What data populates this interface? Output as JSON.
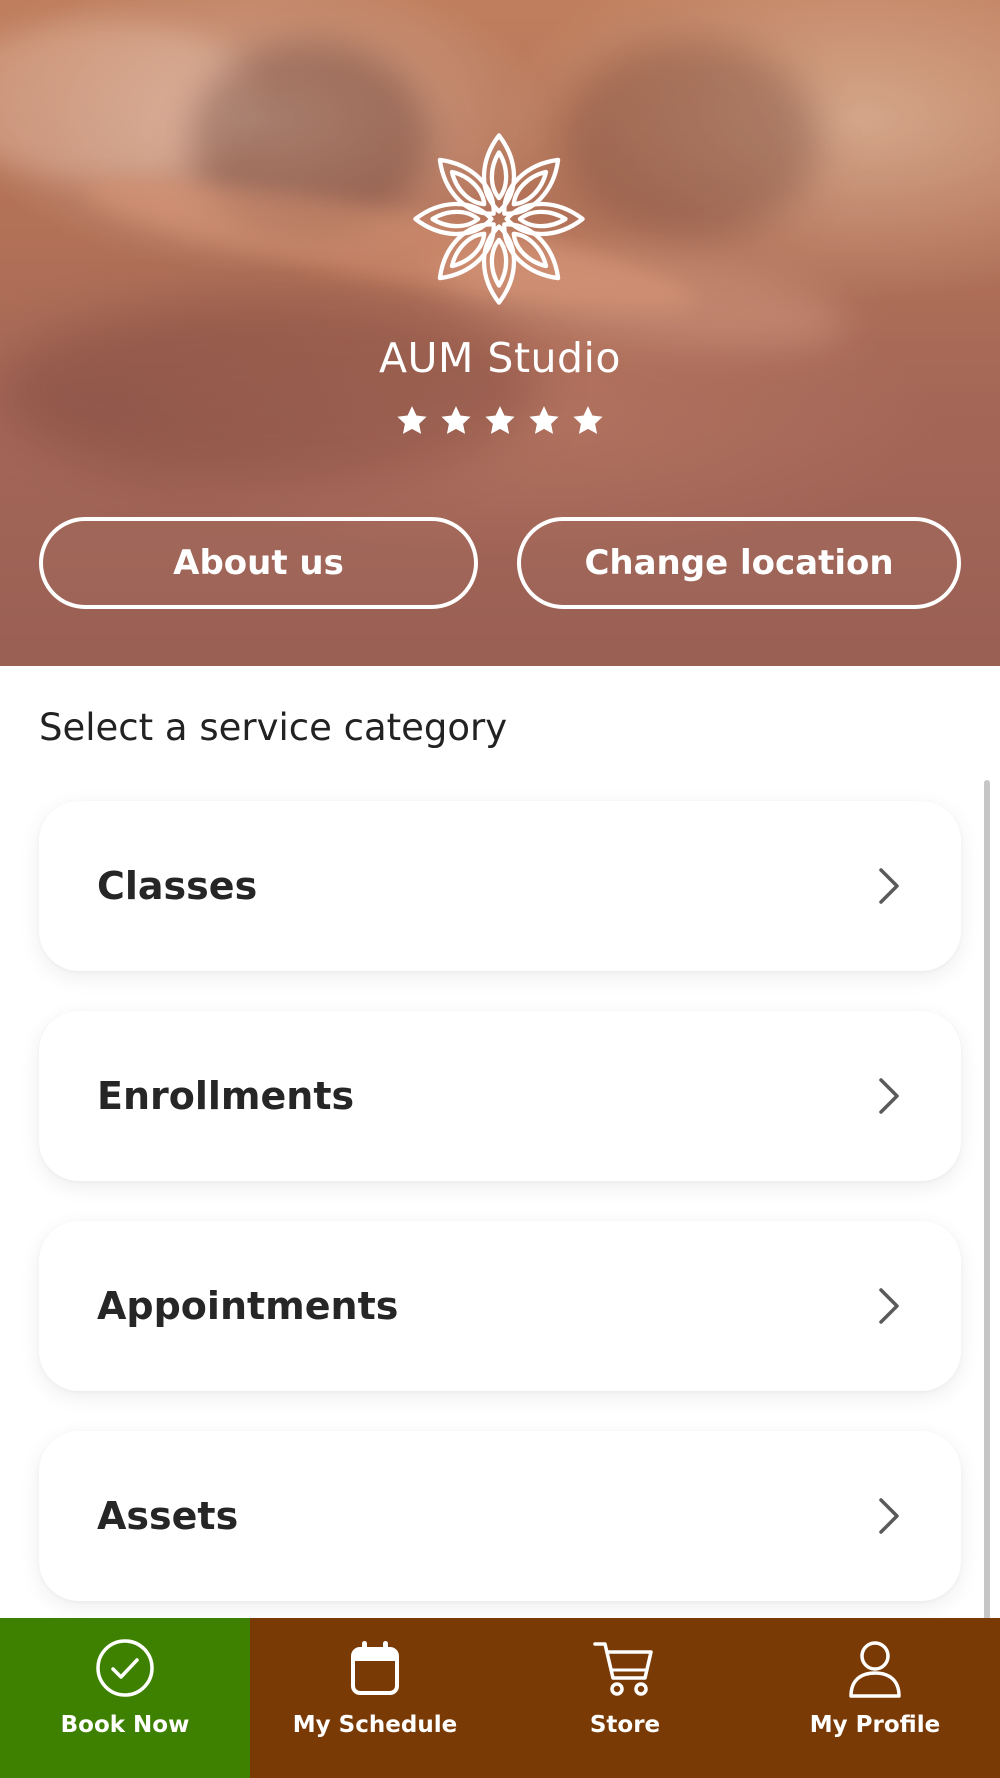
{
  "hero": {
    "studio_name": "AUM Studio",
    "rating": 5,
    "rating_max": 5,
    "about_button": "About us",
    "location_button": "Change location"
  },
  "main": {
    "section_title": "Select a service category",
    "categories": [
      {
        "label": "Classes"
      },
      {
        "label": "Enrollments"
      },
      {
        "label": "Appointments"
      },
      {
        "label": "Assets"
      }
    ]
  },
  "nav": {
    "items": [
      {
        "label": "Book Now",
        "icon": "check-circle-icon",
        "active": true
      },
      {
        "label": "My Schedule",
        "icon": "calendar-icon",
        "active": false
      },
      {
        "label": "Store",
        "icon": "cart-icon",
        "active": false
      },
      {
        "label": "My Profile",
        "icon": "user-icon",
        "active": false
      }
    ]
  },
  "colors": {
    "nav_background": "#7a3a05",
    "nav_active": "#3e8100",
    "card_text": "#262626",
    "chevron": "#5a5a5a"
  }
}
